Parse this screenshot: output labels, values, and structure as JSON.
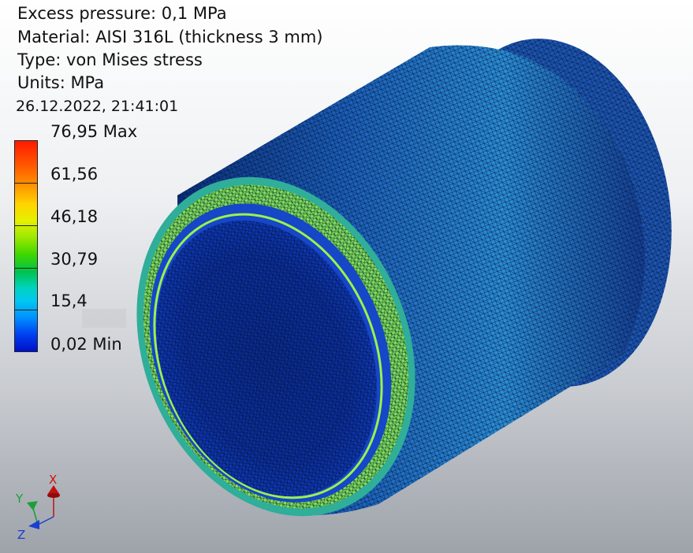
{
  "info": {
    "pressure": "Excess pressure: 0,1 MPa",
    "material": "Material: AISI 316L (thickness 3 mm)",
    "type": "Type: von Mises stress",
    "units": "Units: MPa",
    "timestamp": "26.12.2022, 21:41:01"
  },
  "legend": {
    "labels": [
      "76,95 Max",
      "61,56",
      "46,18",
      "30,79",
      "15,4",
      "0,02 Min"
    ],
    "max": 76.95,
    "min": 0.02
  },
  "axes": {
    "x": "X",
    "y": "Y",
    "z": "Z"
  },
  "colors": {
    "mesh_dark": "#06205a",
    "mesh_blue": "#1f6bd6",
    "mesh_cyan": "#2fb7e8",
    "rim_green": "#8ef04a",
    "background_top": "#ffffff",
    "background_bottom": "#9ea3aa"
  }
}
